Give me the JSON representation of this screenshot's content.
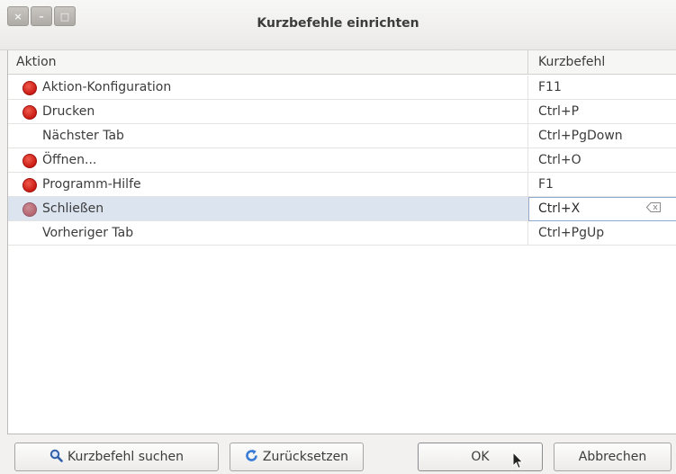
{
  "window": {
    "title": "Kurzbefehle einrichten",
    "wm_buttons": [
      "×",
      "–",
      "□"
    ]
  },
  "table": {
    "headers": [
      "Aktion",
      "Kurzbefehl"
    ],
    "rows": [
      {
        "action": "Aktion-Konfiguration",
        "shortcut": "F11",
        "icon": "red-dot-icon"
      },
      {
        "action": "Drucken",
        "shortcut": "Ctrl+P",
        "icon": "red-dot-icon"
      },
      {
        "action": "Nächster Tab",
        "shortcut": "Ctrl+PgDown",
        "icon": null
      },
      {
        "action": "Öffnen...",
        "shortcut": "Ctrl+O",
        "icon": "red-dot-icon"
      },
      {
        "action": "Programm-Hilfe",
        "shortcut": "F1",
        "icon": "red-dot-icon"
      },
      {
        "action": "Schließen",
        "shortcut": "Ctrl+X",
        "icon": "red-dot-icon",
        "selected": true,
        "editing": true
      },
      {
        "action": "Vorheriger Tab",
        "shortcut": "Ctrl+PgUp",
        "icon": null
      }
    ]
  },
  "buttons": {
    "search": "Kurzbefehl suchen",
    "reset": "Zurücksetzen",
    "ok": "OK",
    "cancel": "Abbrechen"
  },
  "colors": {
    "accent_dot": "#d32a1f",
    "selection": "#dce4f0",
    "search_icon": "#2f5fa8",
    "reset_icon": "#3a7bd5"
  }
}
